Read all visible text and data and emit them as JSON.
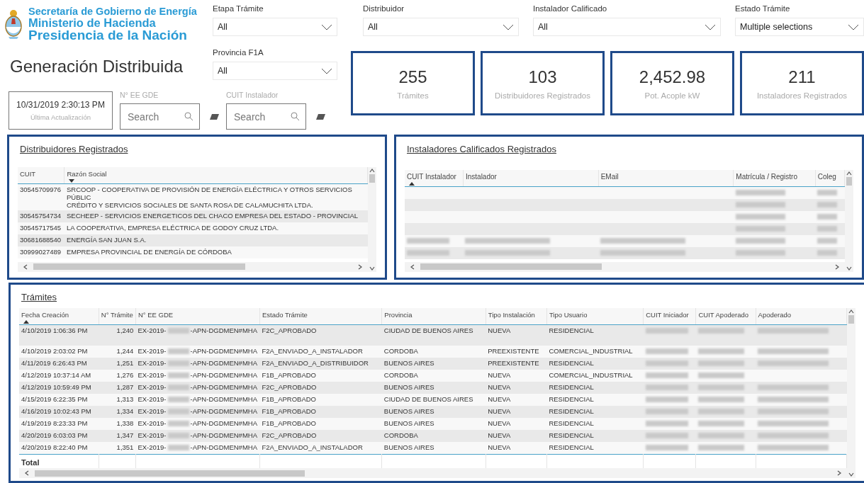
{
  "header": {
    "logo_lines": [
      "Secretaría de Gobierno de Energía",
      "Ministerio de Hacienda",
      "Presidencia de la Nación"
    ],
    "title": "Generación Distribuida"
  },
  "filters": [
    {
      "label": "Etapa Trámite",
      "value": "All"
    },
    {
      "label": "Provincia F1A",
      "value": "All"
    },
    {
      "label": "Distribuidor",
      "value": "All"
    },
    {
      "label": "Instalador Calificado",
      "value": "All"
    },
    {
      "label": "Estado Trámite",
      "value": "Multiple selections"
    }
  ],
  "last_update": {
    "value": "10/31/2019 2:30:13 PM",
    "caption": "Última Actualización"
  },
  "searches": [
    {
      "label": "N° EE GDE",
      "placeholder": "Search"
    },
    {
      "label": "CUIT Instalador",
      "placeholder": "Search"
    }
  ],
  "kpis": [
    {
      "value": "255",
      "label": "Trámites"
    },
    {
      "value": "103",
      "label": "Distribuidores Registrados"
    },
    {
      "value": "2,452.98",
      "label": "Pot. Acople kW"
    },
    {
      "value": "211",
      "label": "Instaladores Registrados"
    }
  ],
  "distribuidores": {
    "title": "Distribuidores Registrados",
    "columns": [
      {
        "label": "CUIT",
        "sorted": false
      },
      {
        "label": "Razón Social",
        "sorted": true,
        "descending": true
      }
    ],
    "rows": [
      {
        "cuit": "30545709976",
        "lines": [
          "SRCOOP - COOPERATIVA DE PROVISIÓN DE ENERGÍA ELÉCTRICA Y OTROS SERVICIOS PÚBLIC",
          "CRÉDITO Y SERVICIOS SOCIALES DE SANTA ROSA DE CALAMUCHITA LTDA."
        ]
      },
      {
        "cuit": "30545754734",
        "lines": [
          "SECHEEP - SERVICIOS ENERGETICOS DEL CHACO EMPRESA DEL ESTADO - PROVINCIAL"
        ]
      },
      {
        "cuit": "30545717545",
        "lines": [
          "LA COOPERATIVA, EMPRESA ELÉCTRICA DE GODOY CRUZ LTDA."
        ]
      },
      {
        "cuit": "30681688540",
        "lines": [
          "ENERGÍA SAN JUAN S.A."
        ]
      },
      {
        "cuit": "30999027489",
        "lines": [
          "EMPRESA PROVINCIAL DE ENERGÍA DE CÓRDOBA"
        ]
      }
    ]
  },
  "instaladores": {
    "title": "Instaladores Calificados Registrados",
    "columns": [
      {
        "label": "CUIT Instalador",
        "sorted": true,
        "descending": false
      },
      {
        "label": "Instalador",
        "sorted": false
      },
      {
        "label": "EMail",
        "sorted": false
      },
      {
        "label": "Matrícula / Registro",
        "sorted": false
      },
      {
        "label": "Coleg",
        "sorted": false
      }
    ],
    "rows": [
      {
        "cells": [
          {
            "kind": "empty"
          },
          {
            "kind": "empty"
          },
          {
            "kind": "empty"
          },
          {
            "kind": "redacted"
          },
          {
            "kind": "redacted"
          }
        ]
      },
      {
        "cells": [
          {
            "kind": "empty"
          },
          {
            "kind": "empty"
          },
          {
            "kind": "empty"
          },
          {
            "kind": "redacted"
          },
          {
            "kind": "redacted"
          }
        ]
      },
      {
        "cells": [
          {
            "kind": "empty"
          },
          {
            "kind": "empty"
          },
          {
            "kind": "empty"
          },
          {
            "kind": "redacted"
          },
          {
            "kind": "redacted"
          }
        ]
      },
      {
        "cells": [
          {
            "kind": "empty"
          },
          {
            "kind": "empty"
          },
          {
            "kind": "empty"
          },
          {
            "kind": "redacted"
          },
          {
            "kind": "redacted"
          }
        ]
      },
      {
        "cells": [
          {
            "kind": "redacted"
          },
          {
            "kind": "redacted"
          },
          {
            "kind": "redacted"
          },
          {
            "kind": "redacted"
          },
          {
            "kind": "redacted"
          }
        ]
      },
      {
        "cells": [
          {
            "kind": "redacted"
          },
          {
            "kind": "redacted"
          },
          {
            "kind": "redacted"
          },
          {
            "kind": "redacted"
          },
          {
            "kind": "redacted"
          }
        ]
      }
    ]
  },
  "tramites": {
    "title": "Trámites",
    "columns": [
      {
        "label": "Fecha Creación",
        "sorted": true,
        "descending": false
      },
      {
        "label": "N° Trámite",
        "sorted": false
      },
      {
        "label": "N° EE GDE",
        "sorted": false
      },
      {
        "label": "Estado Trámite",
        "sorted": false
      },
      {
        "label": "Provincia",
        "sorted": false
      },
      {
        "label": "Tipo Instalación",
        "sorted": false
      },
      {
        "label": "Tipo Usuario",
        "sorted": false
      },
      {
        "label": "CUIT Iniciador",
        "sorted": false
      },
      {
        "label": "CUIT Apoderado",
        "sorted": false
      },
      {
        "label": "Apoderado",
        "sorted": false
      }
    ],
    "rows": [
      {
        "fecha": "4/10/2019 1:06:36 PM",
        "numero": "1,240",
        "ee_prefix": "EX-2019-",
        "ee_suffix": "-APN-DGDMEN#MHA",
        "estado": "F2C_APROBADO",
        "provincia": "CIUDAD DE BUENOS AIRES",
        "tipo_instalacion": "NUEVA",
        "tipo_usuario": "RESIDENCIAL",
        "hidden": [
          {
            "kind": "redacted"
          },
          {
            "kind": "redacted"
          },
          {
            "kind": "redacted"
          }
        ]
      },
      {
        "fecha": "4/10/2019 2:03:02 PM",
        "numero": "1,244",
        "ee_prefix": "EX-2019-",
        "ee_suffix": "-APN-DGDMEN#MHA",
        "estado": "F2A_ENVIADO_A_INSTALADOR",
        "provincia": "CORDOBA",
        "tipo_instalacion": "PREEXISTENTE",
        "tipo_usuario": "COMERCIAL_INDUSTRIAL",
        "hidden": [
          {
            "kind": "redacted"
          },
          {
            "kind": "redacted"
          },
          {
            "kind": "redacted"
          }
        ]
      },
      {
        "fecha": "4/11/2019 6:26:43 PM",
        "numero": "1,251",
        "ee_prefix": "EX-2019-",
        "ee_suffix": "-APN-DGDMEN#MHA",
        "estado": "F2A_ENVIADO_A_DISTRIBUIDOR",
        "provincia": "BUENOS AIRES",
        "tipo_instalacion": "PREEXISTENTE",
        "tipo_usuario": "RESIDENCIAL",
        "hidden": [
          {
            "kind": "redacted"
          },
          {
            "kind": "redacted"
          },
          {
            "kind": "redacted"
          }
        ]
      },
      {
        "fecha": "4/12/2019 10:37:14 AM",
        "numero": "1,276",
        "ee_prefix": "EX-2019-",
        "ee_suffix": "-APN-DGDMEN#MHA",
        "estado": "F1B_APROBADO",
        "provincia": "CORDOBA",
        "tipo_instalacion": "NUEVA",
        "tipo_usuario": "COMERCIAL_INDUSTRIAL",
        "hidden": [
          {
            "kind": "redacted"
          },
          {
            "kind": "redacted"
          },
          {
            "kind": "empty"
          }
        ]
      },
      {
        "fecha": "4/12/2019 10:59:49 PM",
        "numero": "1,287",
        "ee_prefix": "EX-2019-",
        "ee_suffix": "-APN-DGDMEN#MHA",
        "estado": "F2C_APROBADO",
        "provincia": "BUENOS AIRES",
        "tipo_instalacion": "NUEVA",
        "tipo_usuario": "RESIDENCIAL",
        "hidden": [
          {
            "kind": "redacted"
          },
          {
            "kind": "redacted"
          },
          {
            "kind": "redacted"
          }
        ]
      },
      {
        "fecha": "4/15/2019 6:22:35 PM",
        "numero": "1,313",
        "ee_prefix": "EX-2019-",
        "ee_suffix": "-APN-DGDMEN#MHA",
        "estado": "F1B_APROBADO",
        "provincia": "CIUDAD DE BUENOS AIRES",
        "tipo_instalacion": "NUEVA",
        "tipo_usuario": "RESIDENCIAL",
        "hidden": [
          {
            "kind": "redacted"
          },
          {
            "kind": "redacted"
          },
          {
            "kind": "redacted"
          }
        ]
      },
      {
        "fecha": "4/16/2019 10:02:43 PM",
        "numero": "1,334",
        "ee_prefix": "EX-2019-",
        "ee_suffix": "-APN-DGDMEN#MHA",
        "estado": "F1B_APROBADO",
        "provincia": "BUENOS AIRES",
        "tipo_instalacion": "NUEVA",
        "tipo_usuario": "RESIDENCIAL",
        "hidden": [
          {
            "kind": "redacted"
          },
          {
            "kind": "redacted"
          },
          {
            "kind": "redacted"
          }
        ]
      },
      {
        "fecha": "4/19/2019 8:23:33 PM",
        "numero": "1,338",
        "ee_prefix": "EX-2019-",
        "ee_suffix": "-APN-DGDMEN#MHA",
        "estado": "F1B_APROBADO",
        "provincia": "BUENOS AIRES",
        "tipo_instalacion": "NUEVA",
        "tipo_usuario": "RESIDENCIAL",
        "hidden": [
          {
            "kind": "redacted"
          },
          {
            "kind": "redacted"
          },
          {
            "kind": "redacted"
          }
        ]
      },
      {
        "fecha": "4/20/2019 6:03:03 PM",
        "numero": "1,347",
        "ee_prefix": "EX-2019-",
        "ee_suffix": "-APN-DGDMEN#MHA",
        "estado": "F2C_APROBADO",
        "provincia": "CORDOBA",
        "tipo_instalacion": "NUEVA",
        "tipo_usuario": "RESIDENCIAL",
        "hidden": [
          {
            "kind": "redacted"
          },
          {
            "kind": "redacted"
          },
          {
            "kind": "redacted"
          }
        ]
      },
      {
        "fecha": "4/20/2019 8:22:40 PM",
        "numero": "1,351",
        "ee_prefix": "EX-2019-",
        "ee_suffix": "-APN-DGDMEN#MHA",
        "estado": "F2A_ENVIADO_A_INSTALADOR",
        "provincia": "BUENOS AIRES",
        "tipo_instalacion": "NUEVA",
        "tipo_usuario": "RESIDENCIAL",
        "hidden": [
          {
            "kind": "redacted"
          },
          {
            "kind": "redacted"
          },
          {
            "kind": "redacted"
          }
        ]
      }
    ],
    "total_label": "Total"
  }
}
